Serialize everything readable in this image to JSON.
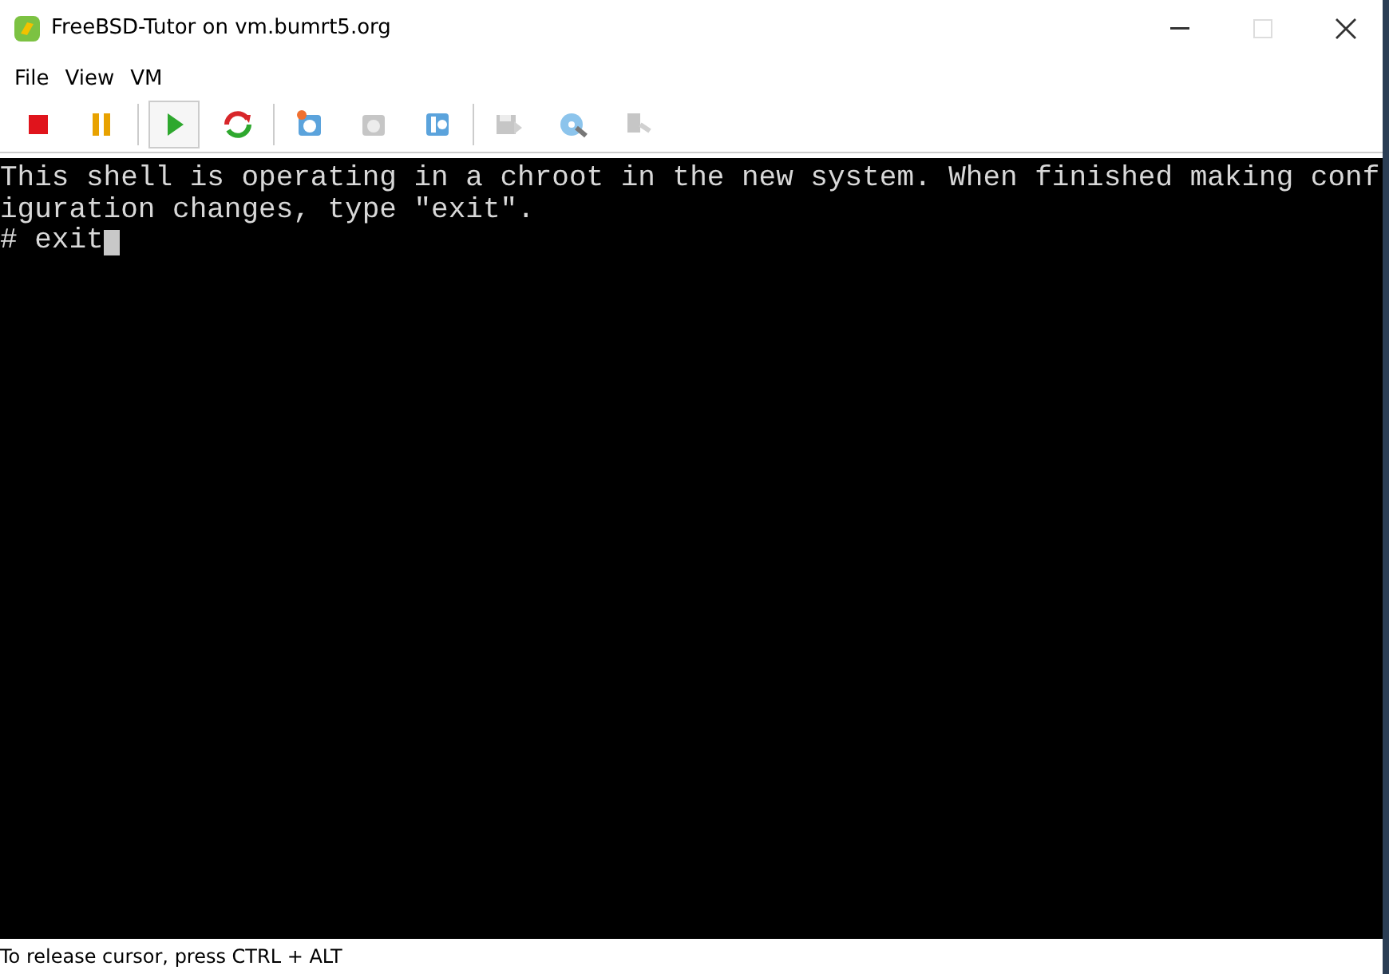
{
  "window": {
    "title": "FreeBSD-Tutor on vm.bumrt5.org"
  },
  "menu": [
    "File",
    "View",
    "VM"
  ],
  "toolbar": [
    {
      "kind": "stop",
      "selected": false,
      "disabled": false
    },
    {
      "kind": "pause",
      "selected": false,
      "disabled": false
    },
    {
      "kind": "play",
      "selected": true,
      "disabled": false
    },
    {
      "kind": "reset",
      "selected": false,
      "disabled": false
    },
    {
      "kind": "snapshot",
      "selected": false,
      "disabled": false
    },
    {
      "kind": "revert",
      "selected": false,
      "disabled": true
    },
    {
      "kind": "manage",
      "selected": false,
      "disabled": false
    },
    {
      "kind": "floppy",
      "selected": false,
      "disabled": true
    },
    {
      "kind": "disc",
      "selected": false,
      "disabled": false
    },
    {
      "kind": "usb",
      "selected": false,
      "disabled": true
    }
  ],
  "console": {
    "lines": [
      "This shell is operating in a chroot in the new system. When finished making conf",
      "iguration changes, type \"exit\".",
      "# exit"
    ],
    "cursor": true
  },
  "status_bar": "To release cursor, press CTRL + ALT"
}
